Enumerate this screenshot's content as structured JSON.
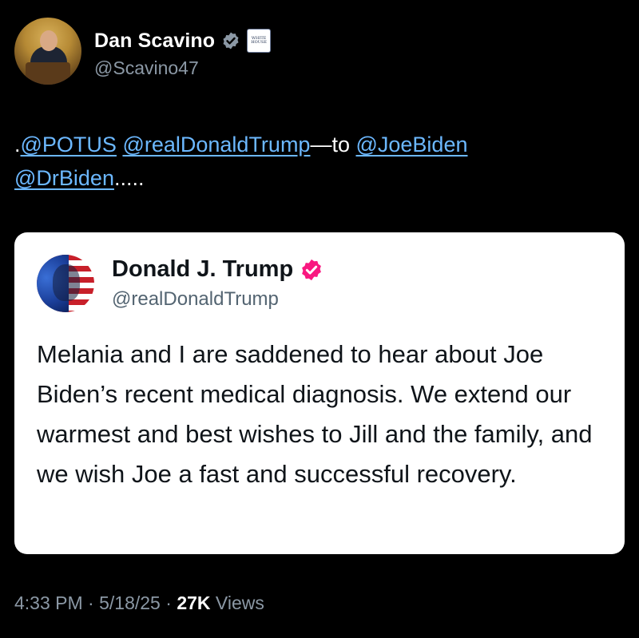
{
  "author": {
    "display_name": "Dan Scavino",
    "handle": "@Scavino47",
    "affiliation_badge_text": "WHITE HOUSE",
    "verified_color": "#8b98a5"
  },
  "tweet": {
    "prefix": ".",
    "mention_potus": "@POTUS",
    "mention_trump": "@realDonaldTrump",
    "connector": "—to ",
    "mention_joebiden": "@JoeBiden",
    "mention_drbiden": "@DrBiden",
    "suffix": "....."
  },
  "quote": {
    "display_name": "Donald J. Trump",
    "handle": "@realDonaldTrump",
    "verified_color": "#f91880",
    "body": "Melania and I are saddened to hear about Joe Biden’s recent medical diagnosis. We extend our warmest and best wishes to Jill and the family, and we wish Joe a fast and successful recovery."
  },
  "meta": {
    "time": "4:33 PM",
    "sep1": " · ",
    "date": "5/18/25",
    "sep2": " · ",
    "views_count": "27K",
    "views_label": " Views"
  },
  "colors": {
    "background": "#000000",
    "link": "#6cb8ff",
    "muted": "#8b98a5",
    "card": "#ffffff"
  }
}
